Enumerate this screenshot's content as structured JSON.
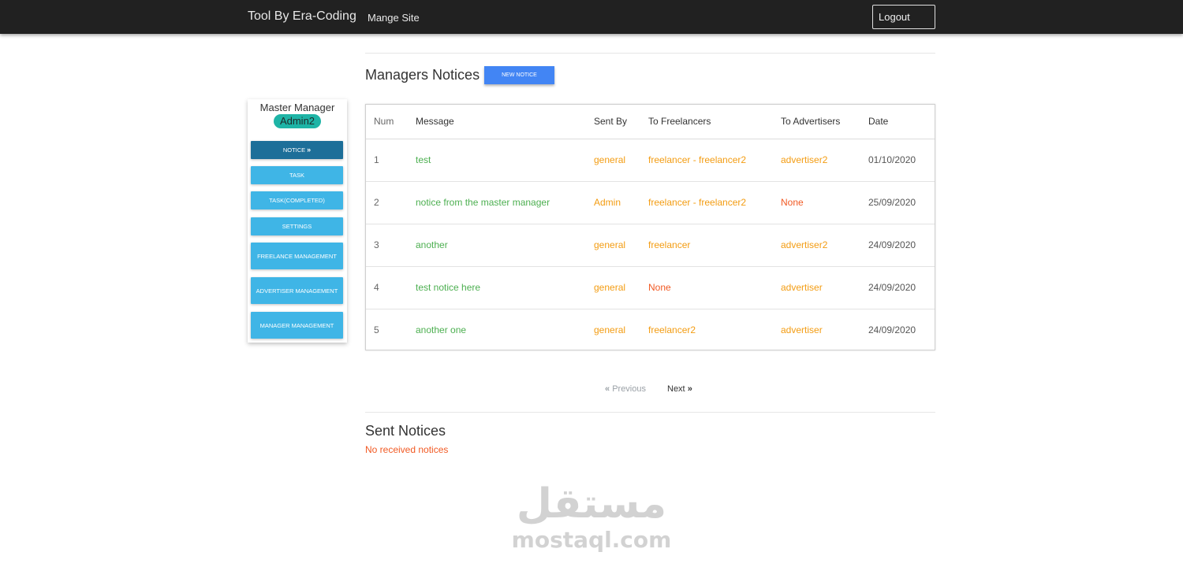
{
  "navbar": {
    "brand": "Tool By Era-Coding",
    "link": "Mange Site",
    "logout": "Logout"
  },
  "sidebar": {
    "title": "Master Manager",
    "badge": "Admin2",
    "items": [
      {
        "label": "NOTICE",
        "active": true
      },
      {
        "label": "TASK"
      },
      {
        "label": "TASK(COMPLETED)"
      },
      {
        "label": "SETTINGS"
      },
      {
        "label": "FREELANCE MANAGEMENT"
      },
      {
        "label": "ADVERTISER MANAGEMENT"
      },
      {
        "label": "MANAGER MANAGEMENT"
      }
    ]
  },
  "notices": {
    "title": "Managers Notices",
    "new_button": "NEW NOTICE",
    "columns": [
      "Num",
      "Message",
      "Sent By",
      "To Freelancers",
      "To Advertisers",
      "Date"
    ],
    "rows": [
      {
        "num": "1",
        "message": "test",
        "sent_by": "general",
        "to_freelancers": "freelancer - freelancer2",
        "to_advertisers": "advertiser2",
        "date": "01/10/2020"
      },
      {
        "num": "2",
        "message": "notice from the master manager",
        "sent_by": "Admin",
        "to_freelancers": "freelancer - freelancer2",
        "to_advertisers": "None",
        "date": "25/09/2020"
      },
      {
        "num": "3",
        "message": "another",
        "sent_by": "general",
        "to_freelancers": "freelancer",
        "to_advertisers": "advertiser2",
        "date": "24/09/2020"
      },
      {
        "num": "4",
        "message": "test notice here",
        "sent_by": "general",
        "to_freelancers": "None",
        "to_advertisers": "advertiser",
        "date": "24/09/2020"
      },
      {
        "num": "5",
        "message": "another one",
        "sent_by": "general",
        "to_freelancers": "freelancer2",
        "to_advertisers": "advertiser",
        "date": "24/09/2020"
      }
    ]
  },
  "pagination": {
    "previous": "Previous",
    "next": "Next"
  },
  "sent": {
    "title": "Sent Notices",
    "empty": "No received notices"
  },
  "watermark": {
    "arabic": "مستقل",
    "latin": "mostaql.com"
  },
  "icons": {
    "chevron_double_right": "chevron-double-right-icon",
    "chevron_double_left": "chevron-double-left-icon"
  },
  "colors": {
    "navbar": "#212121",
    "sidebar_button": "#3fb5e6",
    "sidebar_button_active": "#1d6f99",
    "badge": "#1eb4a6",
    "primary_button": "#4285f4",
    "message_green": "#4caf50",
    "orange": "#f39c12",
    "none_red": "#f15a24"
  }
}
